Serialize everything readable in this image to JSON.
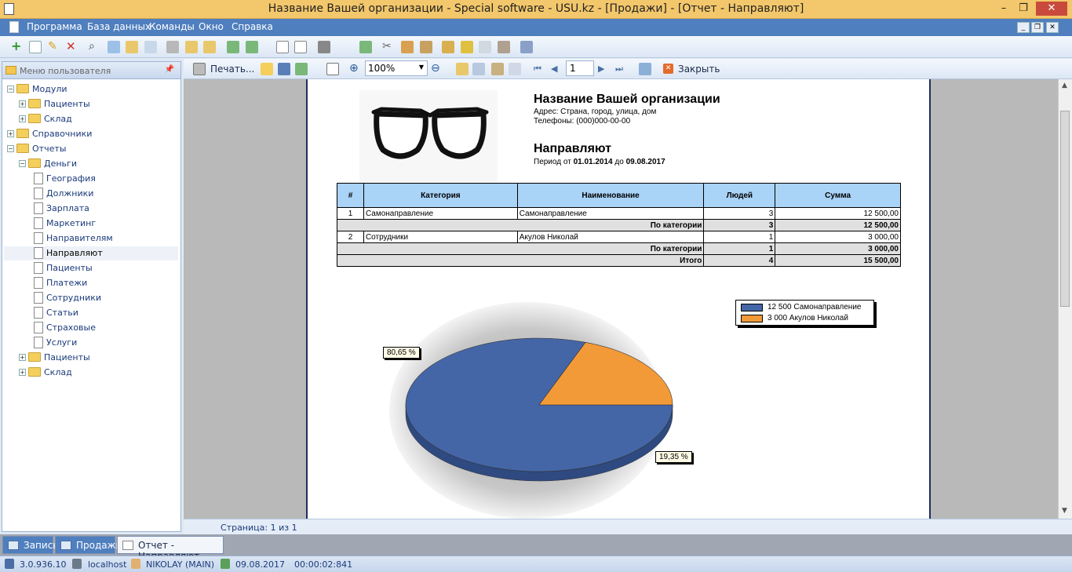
{
  "window": {
    "title": "Название Вашей организации - Special software - USU.kz - [Продажи] - [Отчет - Направляют]",
    "minimize": "–",
    "maximize": "❐",
    "close": "✕"
  },
  "menu": {
    "items": [
      "Программа",
      "База данных",
      "Команды",
      "Окно",
      "Справка"
    ]
  },
  "sidebar": {
    "title": "Меню пользователя",
    "tree": [
      {
        "label": "Модули",
        "type": "folder",
        "expanded": true
      },
      {
        "label": "Пациенты",
        "type": "folder",
        "expanded": false
      },
      {
        "label": "Склад",
        "type": "folder",
        "expanded": false
      },
      {
        "label": "Справочники",
        "type": "folder",
        "expanded": false
      },
      {
        "label": "Отчеты",
        "type": "folder",
        "expanded": true
      },
      {
        "label": "Деньги",
        "type": "folder",
        "expanded": true
      },
      {
        "label": "География",
        "type": "page"
      },
      {
        "label": "Должники",
        "type": "page"
      },
      {
        "label": "Зарплата",
        "type": "page"
      },
      {
        "label": "Маркетинг",
        "type": "page"
      },
      {
        "label": "Направителям",
        "type": "page"
      },
      {
        "label": "Направляют",
        "type": "page",
        "selected": true
      },
      {
        "label": "Пациенты",
        "type": "page"
      },
      {
        "label": "Платежи",
        "type": "page"
      },
      {
        "label": "Сотрудники",
        "type": "page"
      },
      {
        "label": "Статьи",
        "type": "page"
      },
      {
        "label": "Страховые",
        "type": "page"
      },
      {
        "label": "Услуги",
        "type": "page"
      },
      {
        "label": "Пациенты",
        "type": "folder",
        "expanded": false
      },
      {
        "label": "Склад",
        "type": "folder",
        "expanded": false
      }
    ]
  },
  "report_toolbar": {
    "print_label": "Печать...",
    "zoom": "100%",
    "page_number": "1",
    "close_label": "Закрыть"
  },
  "report": {
    "org_name": "Название Вашей организации",
    "address": "Адрес: Страна, город, улица, дом",
    "phones": "Телефоны: (000)000-00-00",
    "report_title": "Направляют",
    "period_prefix": "Период от",
    "period_from": "01.01.2014",
    "period_mid": "до",
    "period_to": "09.08.2017",
    "table": {
      "headers": [
        "#",
        "Категория",
        "Наименование",
        "Людей",
        "Сумма"
      ],
      "rows": [
        {
          "num": "1",
          "category": "Самонаправление",
          "name": "Самонаправление",
          "people": "3",
          "sum": "12 500,00"
        },
        {
          "subtotal_label": "По категории",
          "people": "3",
          "sum": "12 500,00"
        },
        {
          "num": "2",
          "category": "Сотрудники",
          "name": "Акулов Николай",
          "people": "1",
          "sum": "3 000,00"
        },
        {
          "subtotal_label": "По категории",
          "people": "1",
          "sum": "3 000,00"
        },
        {
          "subtotal_label": "Итого",
          "people": "4",
          "sum": "15 500,00"
        }
      ]
    }
  },
  "chart_data": {
    "type": "pie",
    "slices": [
      {
        "label": "12 500 Самонаправление",
        "value": 12500,
        "percent": "80,65 %",
        "color": "#4466a6"
      },
      {
        "label": "3 000 Акулов Николай",
        "value": 3000,
        "percent": "19,35 %",
        "color": "#f29a38"
      }
    ],
    "legend": "top-right"
  },
  "page_status": "Страница: 1 из 1",
  "tabs": [
    {
      "label": "Запись",
      "active": false
    },
    {
      "label": "Продажи",
      "active": false
    },
    {
      "label": "Отчет - Направляют",
      "active": true
    }
  ],
  "status": {
    "version": "3.0.936.10",
    "server": "localhost",
    "user": "NIKOLAY (MAIN)",
    "date": "09.08.2017",
    "timer": "00:00:02:841"
  }
}
